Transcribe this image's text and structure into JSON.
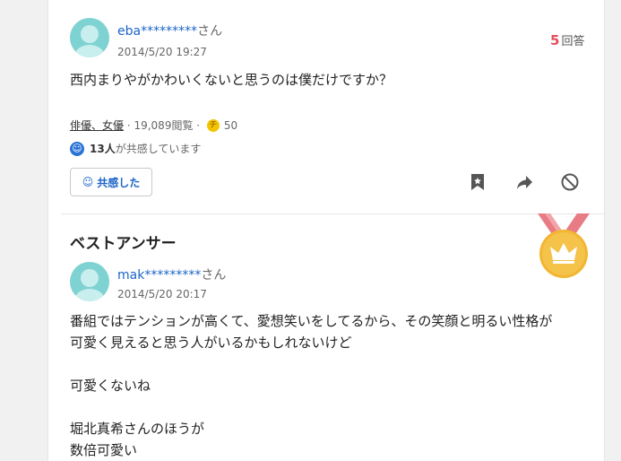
{
  "question": {
    "user_name": "eba*********",
    "user_suffix": "さん",
    "date": "2014/5/20 19:27",
    "answer_count": "5",
    "answer_label": "回答",
    "text": "西内まりやがかわいくないと思うのは僕だけですか？",
    "category": "俳優、女優",
    "views": " · 19,089閲覧 · ",
    "coin_symbol": "チ",
    "coins": "50",
    "empathy_count": "13人",
    "empathy_text": "が共感しています",
    "empathy_button": "共感した"
  },
  "best_answer": {
    "heading": "ベストアンサー",
    "user_name": "mak*********",
    "user_suffix": "さん",
    "date": "2014/5/20 20:17",
    "lines": [
      "番組ではテンションが高くて、愛想笑いをしてるから、その笑顔と明るい性格が",
      "可愛く見えると思う人がいるかもしれないけど",
      "",
      "可愛くないね",
      "",
      "堀北真希さんのほうが",
      "数倍可愛い"
    ]
  },
  "colors": {
    "link_blue": "#1c64c8",
    "answer_red": "#e0505a",
    "avatar_teal": "#7fd2d2",
    "medal_gold": "#f2b632",
    "ribbon_pink": "#e97b85"
  },
  "icons": [
    "smile-icon",
    "coin-icon",
    "bookmark-icon",
    "share-icon",
    "block-icon",
    "crown-medal-icon"
  ]
}
